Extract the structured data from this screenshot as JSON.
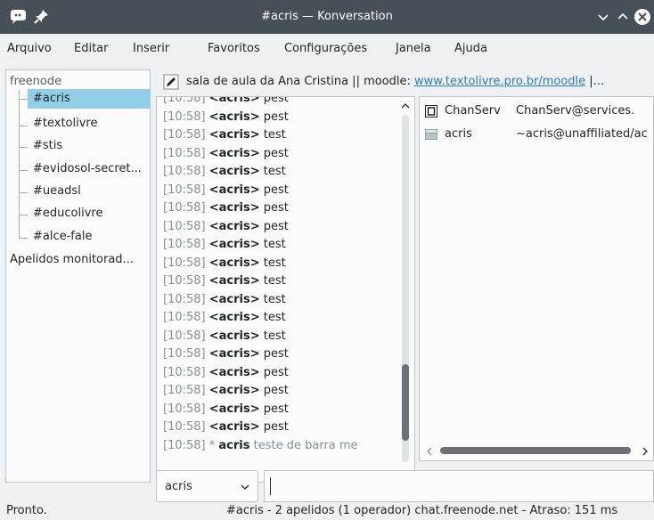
{
  "window": {
    "title": "#acris — Konversation",
    "app_icon": "konversation-icon",
    "pin_icon": "pin-icon"
  },
  "menu": {
    "items": [
      "Arquivo",
      "Editar",
      "Inserir",
      "Favoritos",
      "Configurações",
      "Janela",
      "Ajuda"
    ]
  },
  "sidebar": {
    "network": "freenode",
    "channels": [
      "#acris",
      "#textolivre",
      "#stis",
      "#evidosol-secret...",
      "#ueadsl",
      "#educolivre",
      "#alce-fale"
    ],
    "selected_index": 0,
    "watched": "Apelidos monitorad..."
  },
  "topic": {
    "prefix": "sala de aula da Ana Cristina || moodle: ",
    "link": "www.textolivre.pro.br/moodle",
    "suffix": " |..."
  },
  "chat": {
    "lines": [
      {
        "ts": "[10:58]",
        "nick": "<acris>",
        "msg": " pest"
      },
      {
        "ts": "[10:58]",
        "nick": "<acris>",
        "msg": " pest"
      },
      {
        "ts": "[10:58]",
        "nick": "<acris>",
        "msg": " test"
      },
      {
        "ts": "[10:58]",
        "nick": "<acris>",
        "msg": " pest"
      },
      {
        "ts": "[10:58]",
        "nick": "<acris>",
        "msg": " test"
      },
      {
        "ts": "[10:58]",
        "nick": "<acris>",
        "msg": " pest"
      },
      {
        "ts": "[10:58]",
        "nick": "<acris>",
        "msg": " pest"
      },
      {
        "ts": "[10:58]",
        "nick": "<acris>",
        "msg": " pest"
      },
      {
        "ts": "[10:58]",
        "nick": "<acris>",
        "msg": " test"
      },
      {
        "ts": "[10:58]",
        "nick": "<acris>",
        "msg": " test"
      },
      {
        "ts": "[10:58]",
        "nick": "<acris>",
        "msg": " test"
      },
      {
        "ts": "[10:58]",
        "nick": "<acris>",
        "msg": " test"
      },
      {
        "ts": "[10:58]",
        "nick": "<acris>",
        "msg": " test"
      },
      {
        "ts": "[10:58]",
        "nick": "<acris>",
        "msg": " test"
      },
      {
        "ts": "[10:58]",
        "nick": "<acris>",
        "msg": " pest"
      },
      {
        "ts": "[10:58]",
        "nick": "<acris>",
        "msg": " pest"
      },
      {
        "ts": "[10:58]",
        "nick": "<acris>",
        "msg": " pest"
      },
      {
        "ts": "[10:58]",
        "nick": "<acris>",
        "msg": " pest"
      },
      {
        "ts": "[10:58]",
        "nick": "<acris>",
        "msg": " pest"
      }
    ],
    "action": {
      "ts": "[10:58]",
      "star": " * ",
      "nick": "acris",
      "msg": " teste de barra me"
    }
  },
  "users": [
    {
      "nick": "ChanServ",
      "host": "ChanServ@services.",
      "icon": "operator-icon"
    },
    {
      "nick": "acris",
      "host": "~acris@unaffiliated/ac",
      "icon": "user-icon"
    }
  ],
  "input": {
    "nick": "acris",
    "message": ""
  },
  "status": {
    "left": "Pronto.",
    "right": "#acris - 2 apelidos (1 operador)  chat.freenode.net - Atraso: 151 ms"
  },
  "colors": {
    "titlebar": "#475057",
    "selection": "#93cee9",
    "link": "#2980b9"
  }
}
